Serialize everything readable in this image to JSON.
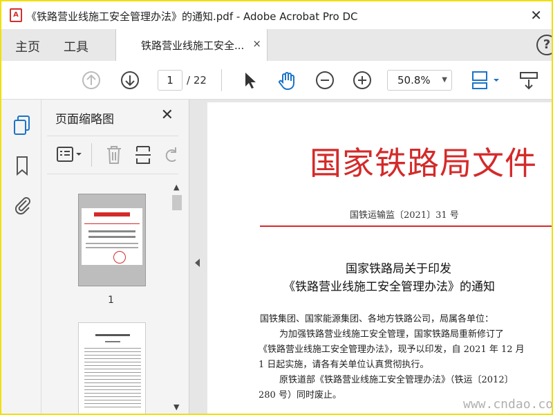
{
  "window": {
    "title": "《铁路营业线施工安全管理办法》的通知.pdf - Adobe Acrobat Pro DC",
    "app_icon_label": "A"
  },
  "menu": {
    "home": "主页",
    "tools": "工具"
  },
  "tab": {
    "label": "铁路营业线施工安全...",
    "close": "×"
  },
  "toolbar": {
    "current_page": "1",
    "total_pages": "/ 22",
    "zoom": "50.8%"
  },
  "thumb_panel": {
    "title": "页面缩略图",
    "page1_label": "1"
  },
  "document": {
    "heading": "国家铁路局文件",
    "number": "国铁运输监〔2021〕31 号",
    "subtitle_line1": "国家铁路局关于印发",
    "subtitle_line2": "《铁路营业线施工安全管理办法》的通知",
    "body": [
      "国铁集团、国家能源集团、各地方铁路公司，局属各单位：",
      "为加强铁路营业线施工安全管理，国家铁路局重新修订了",
      "《铁路营业线施工安全管理办法》，现予以印发，自 2021 年 12 月",
      "1 日起实施，请各有关单位认真贯彻执行。",
      "原铁道部《铁路营业线施工安全管理办法》（铁运〔2012〕",
      "280 号）同时废止。"
    ],
    "seal_char": "铁"
  },
  "watermark": "www.cndao.com",
  "colors": {
    "frame_border": "#f0e000",
    "heading_red": "#d42a2a",
    "tab_bar": "#e8e8e8"
  }
}
